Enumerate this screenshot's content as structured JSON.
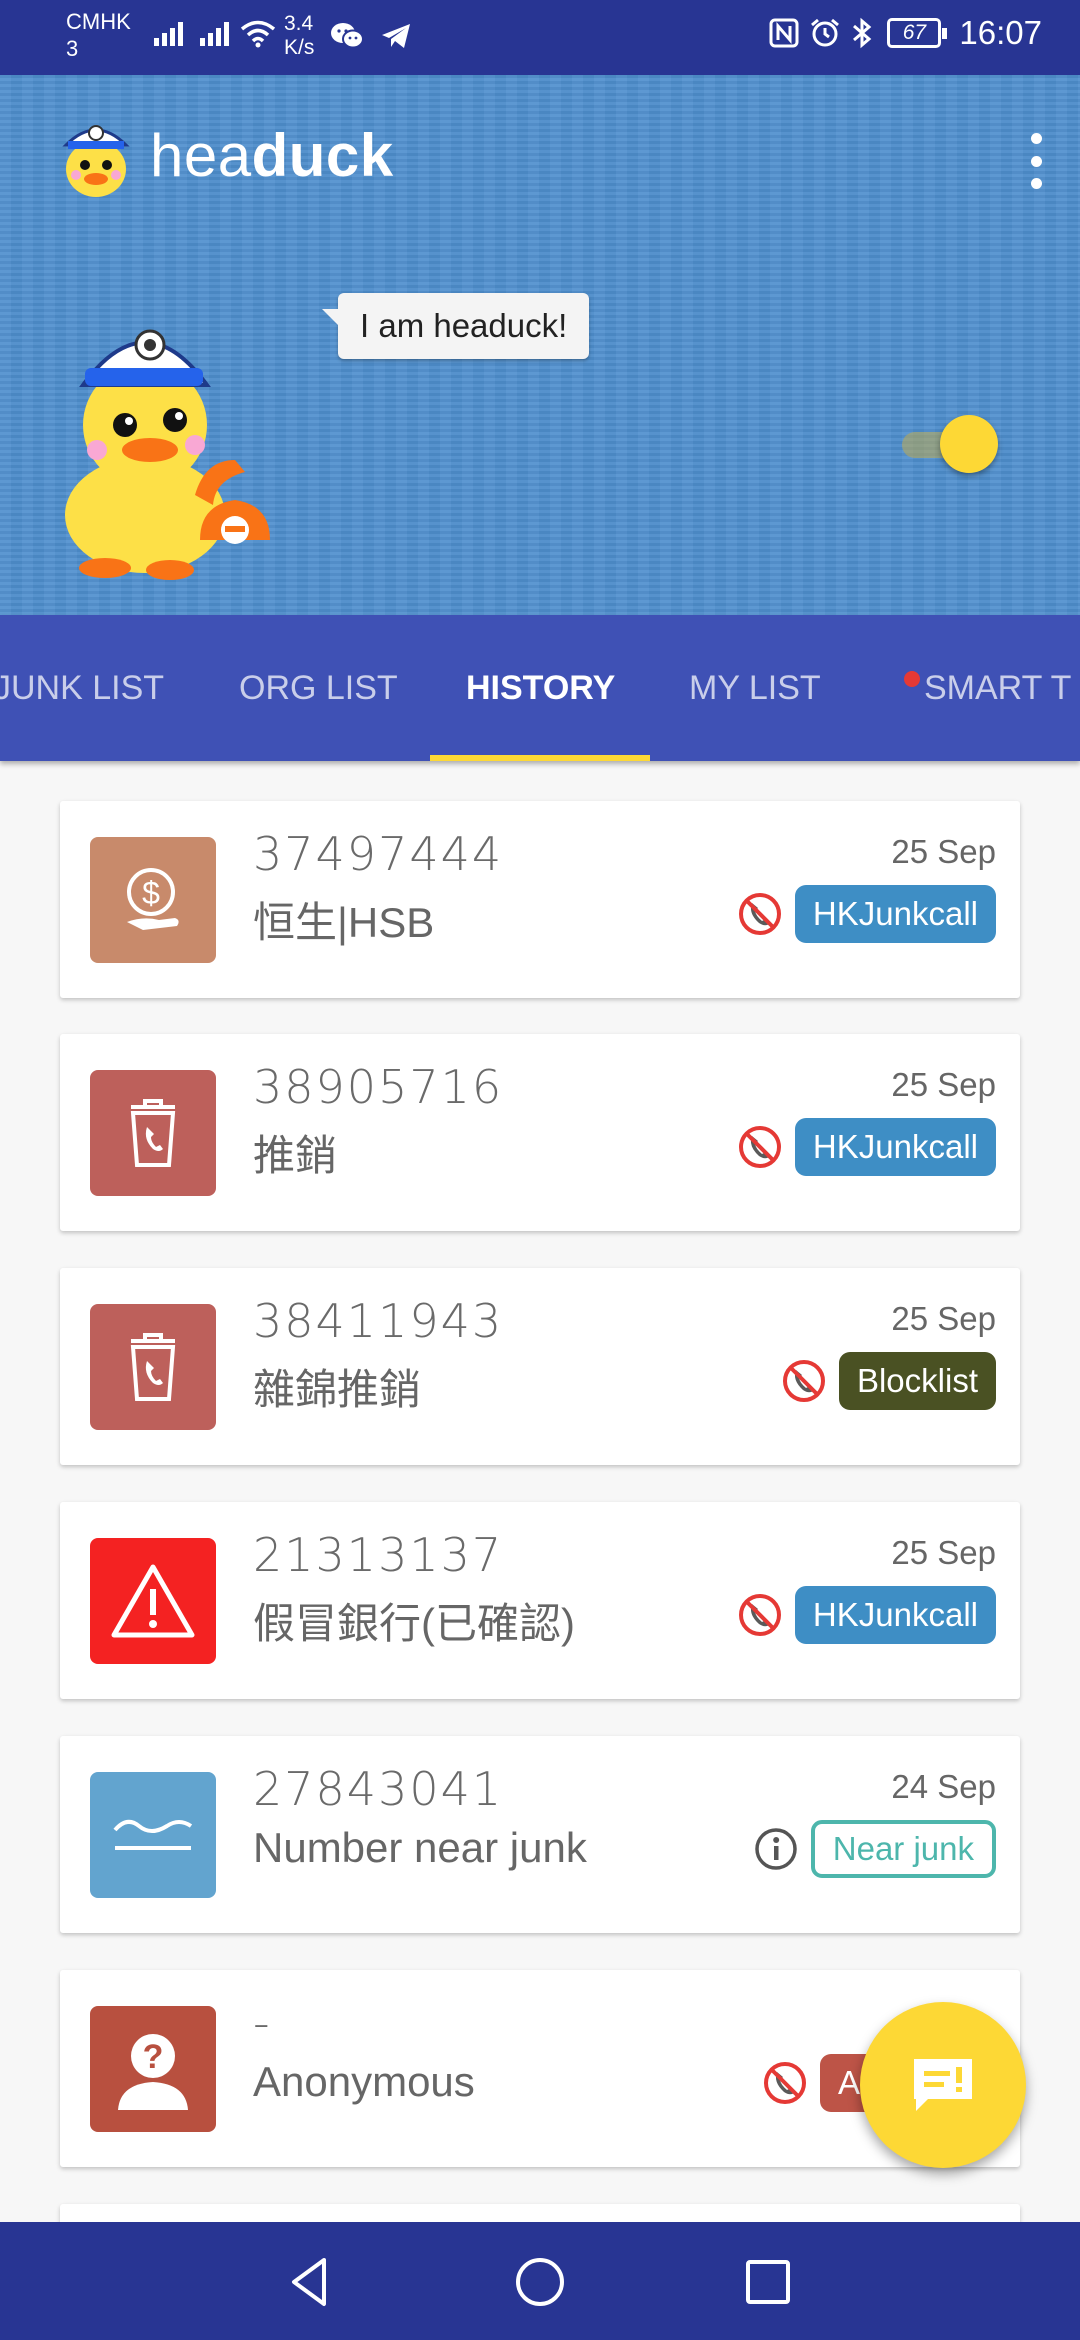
{
  "status_bar": {
    "carrier_line1": "CMHK",
    "carrier_line2": "3",
    "speed_value": "3.4",
    "speed_unit": "K/s",
    "battery": "67",
    "time": "16:07",
    "icons": [
      "signal-icon",
      "signal-icon",
      "wifi-icon",
      "wechat-icon",
      "telegram-icon",
      "nfc-icon",
      "alarm-icon",
      "bluetooth-icon",
      "battery-icon"
    ]
  },
  "header": {
    "title_light": "hea",
    "title_bold": "duck",
    "bubble_text": "I am headuck!",
    "toggle_on": true
  },
  "tabs": [
    {
      "label": "JUNK LIST"
    },
    {
      "label": "ORG LIST"
    },
    {
      "label": "HISTORY",
      "active": true
    },
    {
      "label": "MY LIST"
    },
    {
      "label": "SMART T",
      "has_dot": true
    }
  ],
  "history": [
    {
      "number": "37497444",
      "label": "恒生|HSB",
      "date": "25 Sep",
      "tag": "HKJunkcall",
      "tag_color": "#3e8ec5",
      "status_icon": "blocked-call-icon",
      "category_icon": "money-icon",
      "icon_color": "#c88a6b"
    },
    {
      "number": "38905716",
      "label": "推銷",
      "date": "25 Sep",
      "tag": "HKJunkcall",
      "tag_color": "#3e8ec5",
      "status_icon": "blocked-call-icon",
      "category_icon": "trash-phone-icon",
      "icon_color": "#bd605b"
    },
    {
      "number": "38411943",
      "label": "雜錦推銷",
      "date": "25 Sep",
      "tag": "Blocklist",
      "tag_color": "#4a5123",
      "status_icon": "blocked-call-icon",
      "category_icon": "trash-phone-icon",
      "icon_color": "#bd605b"
    },
    {
      "number": "21313137",
      "label": "假冒銀行(已確認)",
      "date": "25 Sep",
      "tag": "HKJunkcall",
      "tag_color": "#3e8ec5",
      "status_icon": "blocked-call-icon",
      "category_icon": "warning-icon",
      "icon_color": "#f42222"
    },
    {
      "number": "27843041",
      "label": "Number near junk",
      "date": "24 Sep",
      "tag": "Near junk",
      "tag_color": "#4db6ac",
      "status_icon": "info-icon",
      "category_icon": "wave-icon",
      "icon_color": "#62a4cf"
    },
    {
      "number": "-",
      "label": "Anonymous",
      "date": "",
      "tag": "Anon",
      "tag_color": "#bd5447",
      "status_icon": "blocked-call-icon",
      "category_icon": "unknown-person-icon",
      "icon_color": "#b8503f"
    }
  ],
  "fab": {
    "icon": "report-message-icon"
  },
  "nav": {
    "back": "back-icon",
    "home": "home-icon",
    "recents": "recents-icon"
  }
}
